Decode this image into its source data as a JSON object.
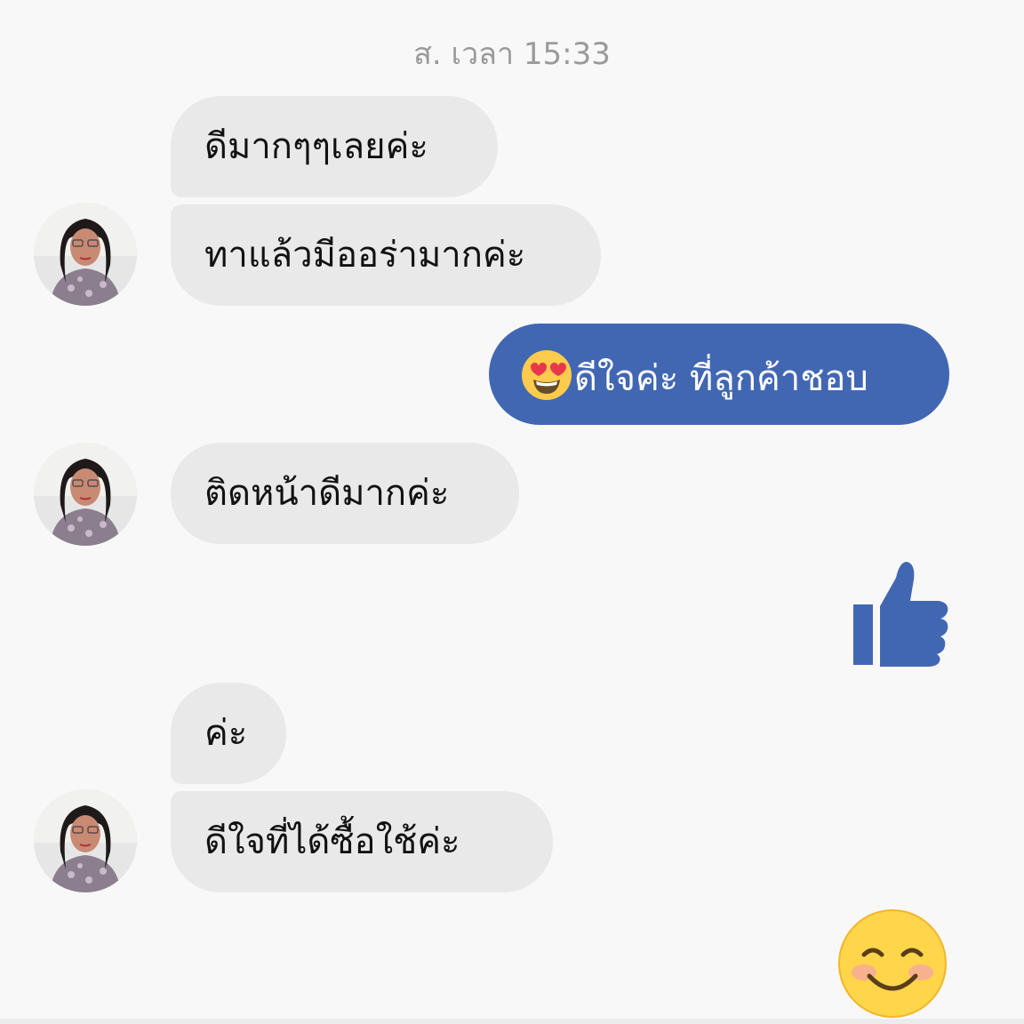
{
  "conversation": {
    "timestamp": "ส. เวลา 15:33",
    "messages": [
      {
        "sender": "contact",
        "text": "ดีมากๆๆเลยค่ะ"
      },
      {
        "sender": "contact",
        "text": "ทาแล้วมีออร่ามากค่ะ"
      },
      {
        "sender": "me",
        "emoji": "heart-eyes-emoji",
        "text": "ดีใจค่ะ ที่ลูกค้าชอบ"
      },
      {
        "sender": "contact",
        "text": "ติดหน้าดีมากค่ะ"
      },
      {
        "sender": "me",
        "sticker": "thumbs-up-icon"
      },
      {
        "sender": "contact",
        "text": "ค่ะ"
      },
      {
        "sender": "contact",
        "text": "ดีใจที่ได้ซื้อใช้ค่ะ"
      },
      {
        "sender": "me",
        "sticker": "smiling-face-emoji"
      }
    ]
  },
  "colors": {
    "background": "#f8f8f8",
    "incoming_bubble": "#e9e9e9",
    "outgoing_bubble": "#4267b2",
    "thumbs_up": "#4267b2",
    "timestamp_text": "#9a9a9a"
  }
}
